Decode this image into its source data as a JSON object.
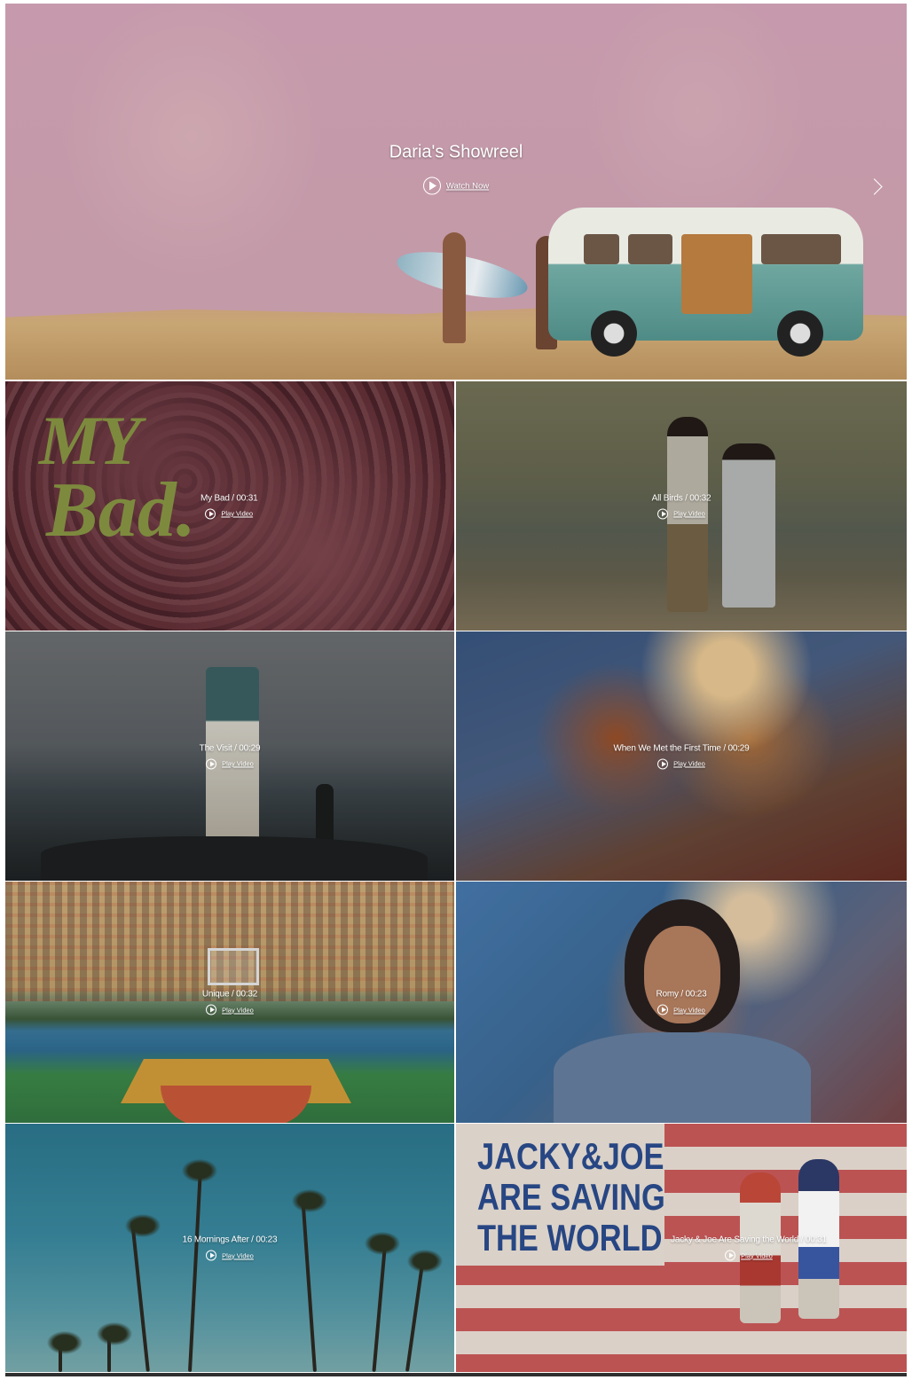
{
  "hero": {
    "title": "Daria's Showreel",
    "cta_label": "Watch Now"
  },
  "tiles": [
    {
      "title": "My Bad / 00:31",
      "cta": "Play Video",
      "art_text": [
        "MY",
        "Bad."
      ]
    },
    {
      "title": "All Birds / 00:32",
      "cta": "Play Video"
    },
    {
      "title": "The Visit / 00:29",
      "cta": "Play Video"
    },
    {
      "title": "When We Met the First Time / 00:29",
      "cta": "Play Video"
    },
    {
      "title": "Unique / 00:32",
      "cta": "Play Video"
    },
    {
      "title": "Romy / 00:23",
      "cta": "Play Video"
    },
    {
      "title": "16 Mornings After / 00:23",
      "cta": "Play Video"
    },
    {
      "title": "Jacky & Joe Are Saving the World / 00:31",
      "cta": "Play Video",
      "art_text": [
        "JACKY&JOE",
        "ARE SAVING",
        "THE WORLD"
      ]
    }
  ],
  "colors": {
    "hero_tint": "#c69aaa",
    "art_green": "#a7b853",
    "art_blue": "#2a4a8b"
  },
  "icons": {
    "play": "play-circle-icon",
    "next": "chevron-right-icon"
  }
}
